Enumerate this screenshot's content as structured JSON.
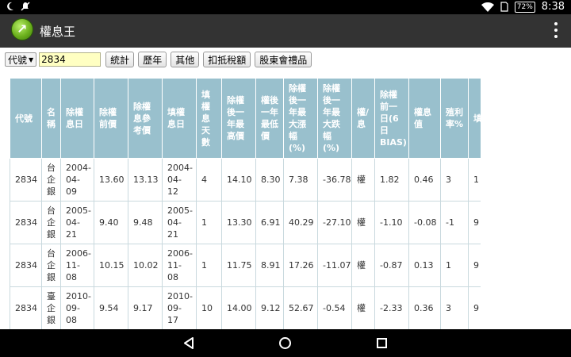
{
  "status_bar": {
    "left_icons": [
      "moon-icon",
      "mute-icon"
    ],
    "battery": "72%",
    "time": "8:38"
  },
  "app_bar": {
    "title": "權息王",
    "icon": "app-logo-icon"
  },
  "toolbar": {
    "select_value": "代號",
    "code_value": "2834",
    "buttons": [
      "統計",
      "歷年",
      "其他",
      "扣抵稅額",
      "股東會禮品"
    ]
  },
  "table": {
    "headers": [
      "代號",
      "名稱",
      "除權息日",
      "除權前價",
      "除權息參考價",
      "填權息日",
      "填權息天數",
      "除權後一年最高價",
      "權後一年最低價",
      "除權後一年最大漲幅(%)",
      "除權後一年最大跌幅(%)",
      "權/息",
      "除權前一日(6日BIAS)",
      "權息值",
      "殖利率%",
      "填權息"
    ],
    "rows": [
      [
        "2834",
        "台企銀",
        "2004-04-09",
        "13.60",
        "13.13",
        "2004-04-12",
        "4",
        "14.10",
        "8.30",
        "7.38",
        "-36.78",
        "權",
        "1.82",
        "0.46",
        "3",
        "1"
      ],
      [
        "2834",
        "台企銀",
        "2005-04-21",
        "9.40",
        "9.48",
        "2005-04-21",
        "1",
        "13.30",
        "6.91",
        "40.29",
        "-27.10",
        "權",
        "-1.10",
        "-0.08",
        "-1",
        "9"
      ],
      [
        "2834",
        "台企銀",
        "2006-11-08",
        "10.15",
        "10.02",
        "2006-11-08",
        "1",
        "11.75",
        "8.91",
        "17.26",
        "-11.07",
        "權",
        "-0.87",
        "0.13",
        "1",
        "9"
      ],
      [
        "2834",
        "臺企銀",
        "2010-09-08",
        "9.54",
        "9.17",
        "2010-09-17",
        "10",
        "14.00",
        "9.12",
        "52.67",
        "-0.54",
        "權",
        "-2.33",
        "0.36",
        "3",
        "9"
      ]
    ]
  },
  "nav_bar": {
    "icons": [
      "back-icon",
      "home-icon",
      "recent-apps-icon"
    ]
  }
}
